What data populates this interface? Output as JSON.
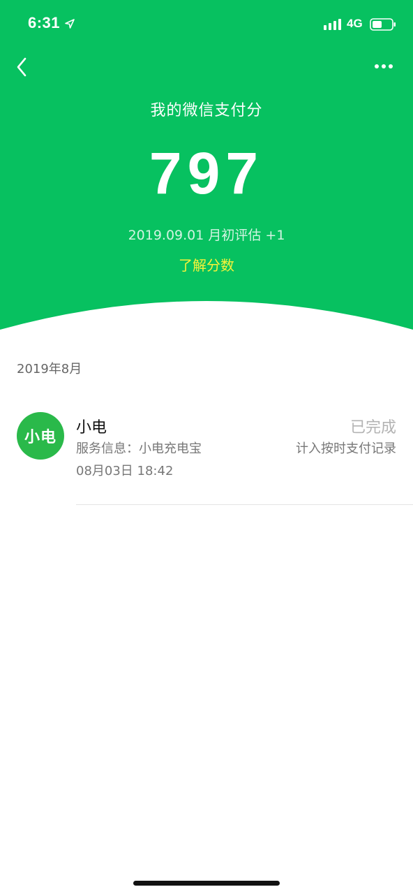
{
  "status_bar": {
    "time": "6:31",
    "network": "4G",
    "location_icon": "location-arrow-icon",
    "signal_icon": "cellular-signal-icon",
    "battery_icon": "battery-icon"
  },
  "nav": {
    "back_icon": "chevron-left-icon",
    "more_icon": "more-dots-icon"
  },
  "score_card": {
    "title": "我的微信支付分",
    "score": "797",
    "evaluation": "2019.09.01 月初评估 +1",
    "learn_more": "了解分数"
  },
  "records": {
    "month": "2019年8月",
    "items": [
      {
        "avatar_text": "小电",
        "merchant": "小电",
        "service": "服务信息：小电充电宝",
        "time": "08月03日 18:42",
        "status": "已完成",
        "note": "计入按时支付记录"
      }
    ]
  },
  "colors": {
    "brand_green": "#07c160",
    "avatar_green": "#2ab94a",
    "link_yellow": "#f7f33a",
    "status_gray": "#b3b3b3"
  }
}
